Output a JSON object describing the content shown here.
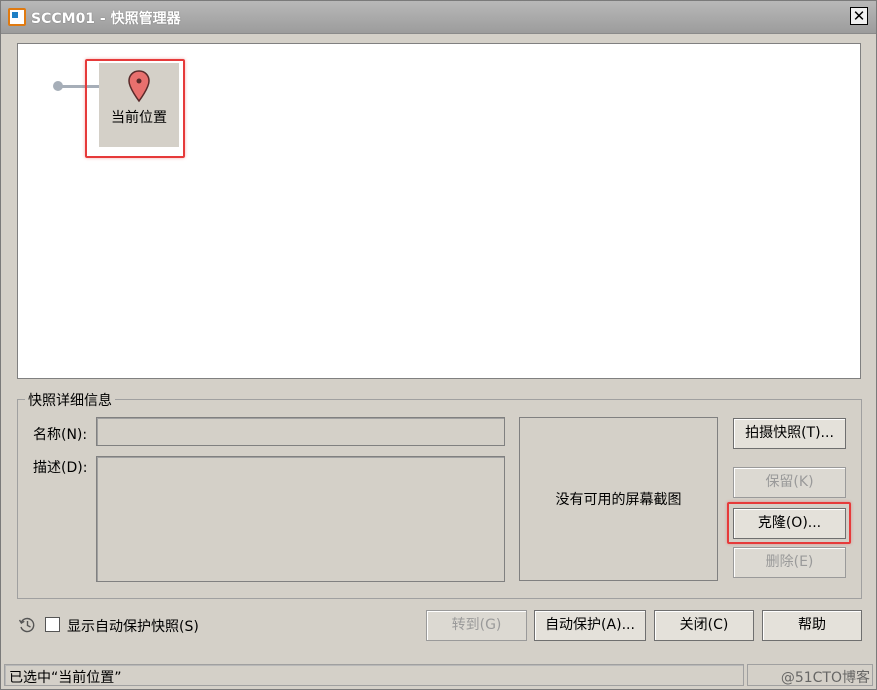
{
  "window": {
    "title": "SCCM01 - 快照管理器",
    "close_glyph": "✕"
  },
  "tree": {
    "current_node_label": "当前位置"
  },
  "details": {
    "group_title": "快照详细信息",
    "name_label": "名称(N):",
    "name_value": "",
    "desc_label": "描述(D):",
    "desc_value": "",
    "no_screenshot": "没有可用的屏幕截图"
  },
  "side_buttons": {
    "take_snapshot": "拍摄快照(T)...",
    "keep": "保留(K)",
    "clone": "克隆(O)...",
    "delete": "删除(E)"
  },
  "bottom": {
    "show_autoprotect": "显示自动保护快照(S)",
    "goto": "转到(G)",
    "autoprotect": "自动保护(A)...",
    "close": "关闭(C)",
    "help": "帮助"
  },
  "status": {
    "text": "已选中“当前位置”",
    "watermark": "@51CTO博客"
  },
  "colors": {
    "highlight": "#e63a3a",
    "pin": "#e8706e",
    "connector": "#a6aeb8"
  }
}
